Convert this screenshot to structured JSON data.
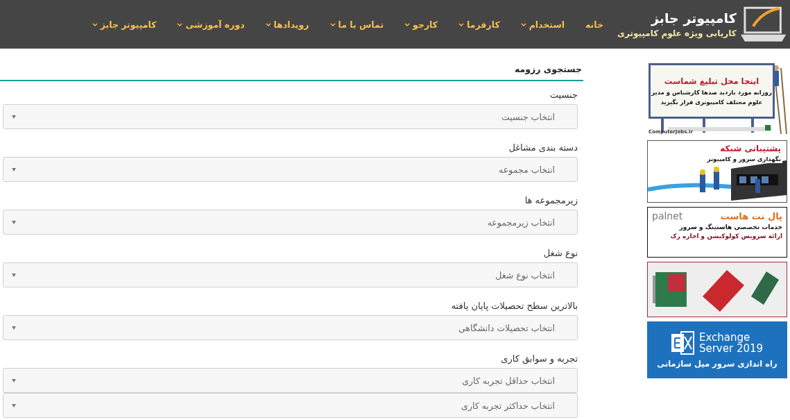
{
  "header": {
    "logo_title": "کامپیوتر جابز",
    "logo_subtitle": "کاریابی ویژه علوم کامپیوتری",
    "nav": [
      {
        "label": "خانه",
        "dropdown": false
      },
      {
        "label": "استخدام",
        "dropdown": true
      },
      {
        "label": "کارفرما",
        "dropdown": true
      },
      {
        "label": "کارجو",
        "dropdown": true
      },
      {
        "label": "تماس با ما",
        "dropdown": true
      },
      {
        "label": "رویدادها",
        "dropdown": true
      },
      {
        "label": "دوره آموزشی",
        "dropdown": true
      },
      {
        "label": "کامپیوتر جابز",
        "dropdown": true
      }
    ]
  },
  "form": {
    "title": "جستجوی رزومه",
    "fields": [
      {
        "label": "جنسیت",
        "selects": [
          "انتخاب جنسیت"
        ]
      },
      {
        "label": "دسته بندی مشاغل",
        "selects": [
          "انتخاب مجموعه"
        ]
      },
      {
        "label": "زیرمجموعه ها",
        "selects": [
          "انتخاب زیرمجموعه"
        ]
      },
      {
        "label": "نوع شغل",
        "selects": [
          "انتخاب نوع شغل"
        ]
      },
      {
        "label": "بالاترین سطح تحصیلات پایان یافته",
        "selects": [
          "انتخاب تحصیلات دانشگاهی"
        ]
      },
      {
        "label": "تجربه و سوابق کاری",
        "selects": [
          "انتخاب حداقل تجربه کاری",
          "انتخاب حداکثر تجربه کاری"
        ]
      }
    ]
  },
  "ads": [
    {
      "kind": "billboard",
      "title": "اینجا محل تبلیغ شماست",
      "lines": [
        "روزانه مورد بازدید صدها کارشناس و مدیر",
        "علوم مختلف کامپیوتری قرار بگیرید"
      ],
      "brand": "ComputerJobs.ir"
    },
    {
      "kind": "network",
      "title": "پشتیبانی شبکه",
      "lines": [
        "نگهداری سرور و کامپیوتر"
      ]
    },
    {
      "kind": "hosting",
      "title": "پال نت هاست",
      "brand": "palnet",
      "lines": [
        "خدمات تخصصی هاستینگ و سرور",
        "ارائه سرویس کولوکیشن و اجاره رک"
      ]
    },
    {
      "kind": "picture"
    },
    {
      "kind": "exchange",
      "brand": "Exchange",
      "subbrand": "Server 2019",
      "lines": [
        "راه اندازی سرور میل سازمانی"
      ]
    }
  ]
}
